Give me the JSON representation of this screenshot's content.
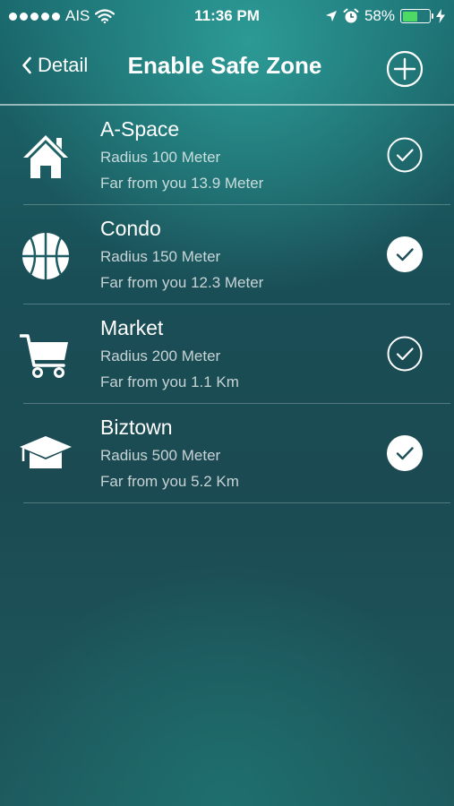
{
  "status": {
    "carrier": "AIS",
    "time": "11:36 PM",
    "battery_percent": "58%",
    "battery_level": 0.58
  },
  "nav": {
    "back_label": "Detail",
    "title": "Enable Safe Zone"
  },
  "zones": [
    {
      "name": "A-Space",
      "radius": "Radius 100 Meter",
      "distance": "Far from you 13.9 Meter",
      "icon": "house-icon",
      "checked": false
    },
    {
      "name": "Condo",
      "radius": "Radius 150 Meter",
      "distance": "Far from you 12.3 Meter",
      "icon": "basketball-icon",
      "checked": true
    },
    {
      "name": "Market",
      "radius": "Radius 200 Meter",
      "distance": "Far from you 1.1 Km",
      "icon": "cart-icon",
      "checked": false
    },
    {
      "name": "Biztown",
      "radius": "Radius 500 Meter",
      "distance": "Far from you 5.2 Km",
      "icon": "graduation-cap-icon",
      "checked": true
    }
  ]
}
